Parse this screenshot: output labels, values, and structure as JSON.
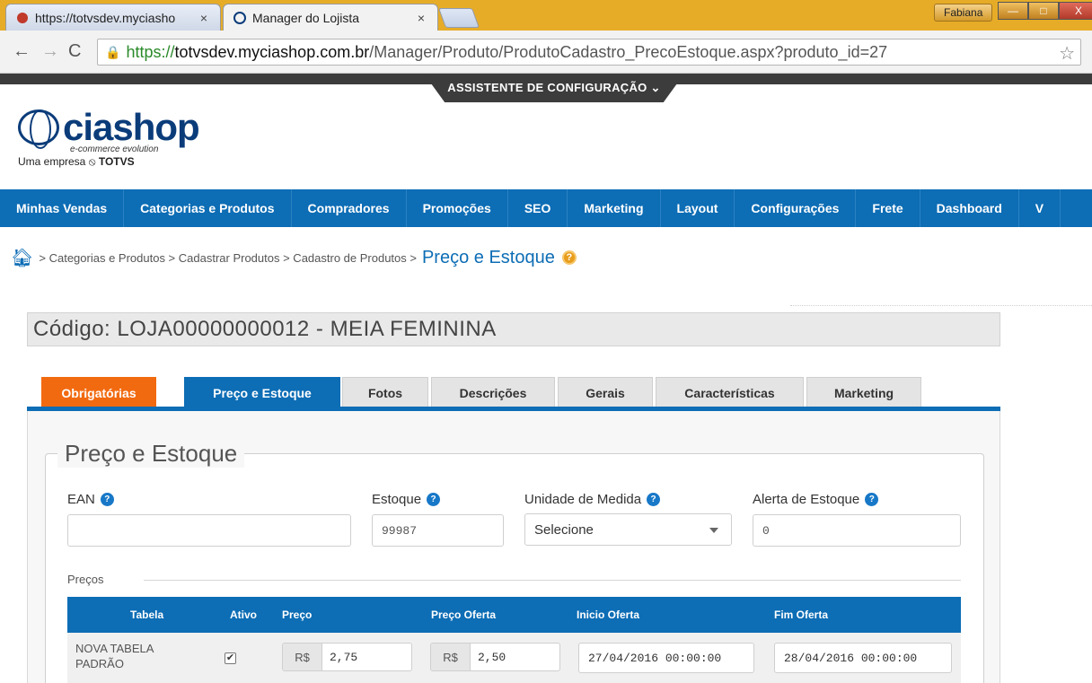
{
  "browser": {
    "tabs": [
      {
        "title": "https://totvsdev.myciasho",
        "close": "×"
      },
      {
        "title": "Manager do Lojista",
        "close": "×"
      }
    ],
    "user": "Fabiana",
    "address": {
      "https": "https://",
      "host": "totvsdev.myciashop.com.br",
      "path": "/Manager/Produto/ProdutoCadastro_PrecoEstoque.aspx?produto_id=27"
    },
    "window_buttons": {
      "minimize": "—",
      "maximize": "□",
      "close": "X"
    }
  },
  "assistant": {
    "label": "ASSISTENTE DE CONFIGURAÇÃO ⌄"
  },
  "logo": {
    "word": "ciashop",
    "tagline": "e-commerce evolution",
    "company_prefix": "Uma empresa",
    "company": "TOTVS"
  },
  "nav": [
    "Minhas Vendas",
    "Categorias e Produtos",
    "Compradores",
    "Promoções",
    "SEO",
    "Marketing",
    "Layout",
    "Configurações",
    "Frete",
    "Dashboard",
    "V"
  ],
  "breadcrumb": {
    "path": "> Categorias e Produtos > Cadastrar Produtos > Cadastro de Produtos >",
    "current": "Preço e Estoque"
  },
  "product": {
    "code_label": "Código: LOJA00000000012 - MEIA FEMININA"
  },
  "tabs": [
    "Obrigatórias",
    "Preço e Estoque",
    "Fotos",
    "Descrições",
    "Gerais",
    "Características",
    "Marketing"
  ],
  "section": {
    "title": "Preço e Estoque"
  },
  "fields": {
    "ean": {
      "label": "EAN",
      "value": ""
    },
    "estoque": {
      "label": "Estoque",
      "value": "99987"
    },
    "unidade": {
      "label": "Unidade de Medida",
      "value": "Selecione"
    },
    "alerta": {
      "label": "Alerta de Estoque",
      "value": "0"
    }
  },
  "precos": {
    "title": "Preços",
    "headers": [
      "Tabela",
      "Ativo",
      "Preço",
      "Preço Oferta",
      "Inicio Oferta",
      "Fim Oferta"
    ],
    "rows": [
      {
        "tabela": "NOVA TABELA PADRÃO",
        "ativo": "✔",
        "currency": "R$",
        "preco": "2,75",
        "preco_oferta": "2,50",
        "inicio": "27/04/2016 00:00:00",
        "fim": "28/04/2016 00:00:00"
      }
    ]
  },
  "help_glyph": "?",
  "colors": {
    "primary": "#0d6db5",
    "accent": "#f26a10",
    "help": "#e89d1c"
  }
}
